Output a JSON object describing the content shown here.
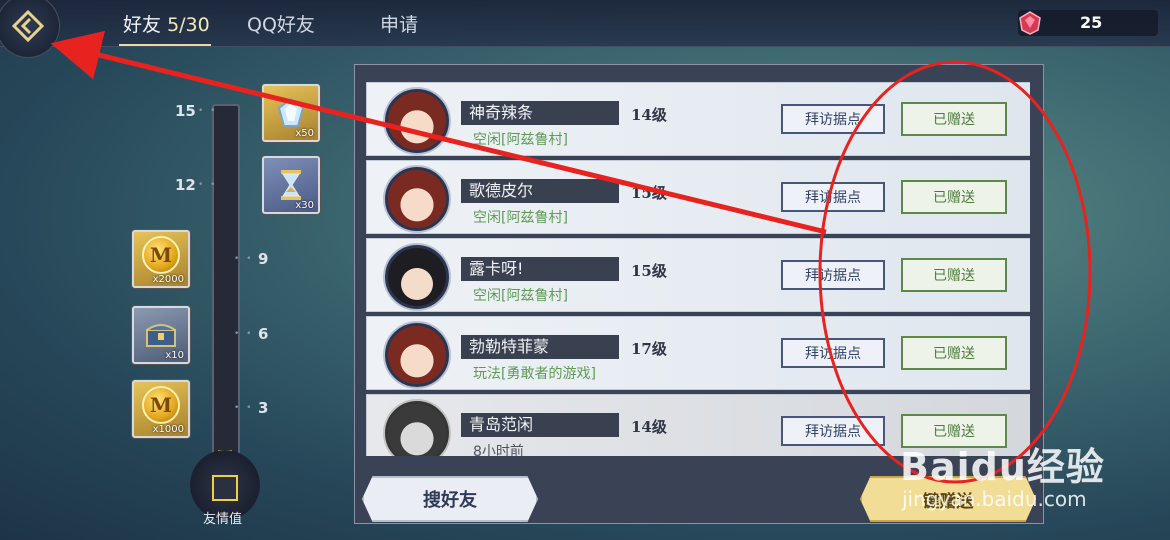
{
  "header": {
    "tabs": [
      {
        "label": "好友",
        "count": "5/30"
      },
      {
        "label": "QQ好友"
      },
      {
        "label": "申请"
      }
    ],
    "currency_value": "25"
  },
  "friendship_track": {
    "label": "友情值",
    "milestones": [
      "15",
      "12",
      "9",
      "6",
      "3"
    ],
    "rewards": [
      {
        "icon": "crystal-icon",
        "qty": "x50"
      },
      {
        "icon": "hourglass-icon",
        "qty": "x30"
      },
      {
        "icon": "gold-coin-icon",
        "qty": "x2000",
        "glyph": "M"
      },
      {
        "icon": "chest-icon",
        "qty": "x10"
      },
      {
        "icon": "gold-coin-icon",
        "qty": "x1000",
        "glyph": "M"
      }
    ]
  },
  "friends": [
    {
      "name": "神奇辣条",
      "level": "14级",
      "status": "空闲[阿兹鲁村]",
      "visit": "拜访据点",
      "gift": "已赠送"
    },
    {
      "name": "歌德皮尔",
      "level": "15级",
      "status": "空闲[阿兹鲁村]",
      "visit": "拜访据点",
      "gift": "已赠送"
    },
    {
      "name": "露卡呀!",
      "level": "15级",
      "status": "空闲[阿兹鲁村]",
      "visit": "拜访据点",
      "gift": "已赠送"
    },
    {
      "name": "勃勒特菲蒙",
      "level": "17级",
      "status": "玩法[勇敢者的游戏]",
      "visit": "拜访据点",
      "gift": "已赠送"
    },
    {
      "name": "青岛范闲",
      "level": "14级",
      "status": "8小时前",
      "visit": "拜访据点",
      "gift": "已赠送"
    }
  ],
  "footer": {
    "search_label": "搜好友",
    "gift_all_label": "键赠送"
  },
  "watermark": {
    "logo": "Baidu经验",
    "url": "jingyan.baidu.com"
  },
  "colors": {
    "annotation": "#e8231f",
    "gold": "#e8c640"
  }
}
